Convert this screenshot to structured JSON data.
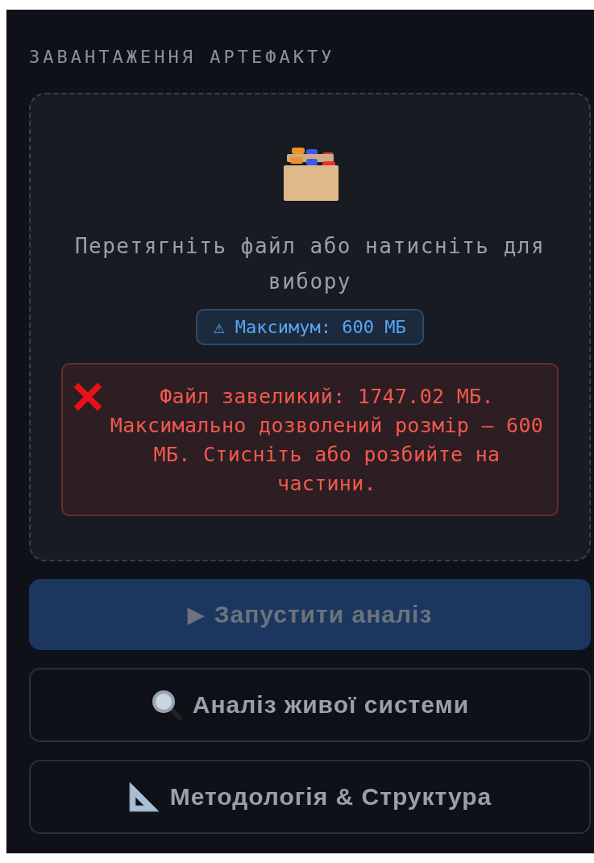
{
  "section_title": "ЗАВАНТАЖЕННЯ АРТЕФАКТУ",
  "dropzone": {
    "prompt": "Перетягніть файл або натисніть для вибору",
    "limit_badge": "⚠ Максимум: 600 МБ",
    "error": "Файл завеликий: 1747.02 МБ. Максимально дозволений розмір — 600 МБ. Стисніть або розбийте на частини."
  },
  "buttons": [
    {
      "kind": "primary",
      "icon": "▶",
      "label": "Запустити аналіз",
      "disabled": true
    },
    {
      "kind": "magnifier",
      "label": "Аналіз живої системи",
      "disabled": false
    },
    {
      "kind": "set-square",
      "label": "Методологія & Структура",
      "disabled": false
    }
  ]
}
